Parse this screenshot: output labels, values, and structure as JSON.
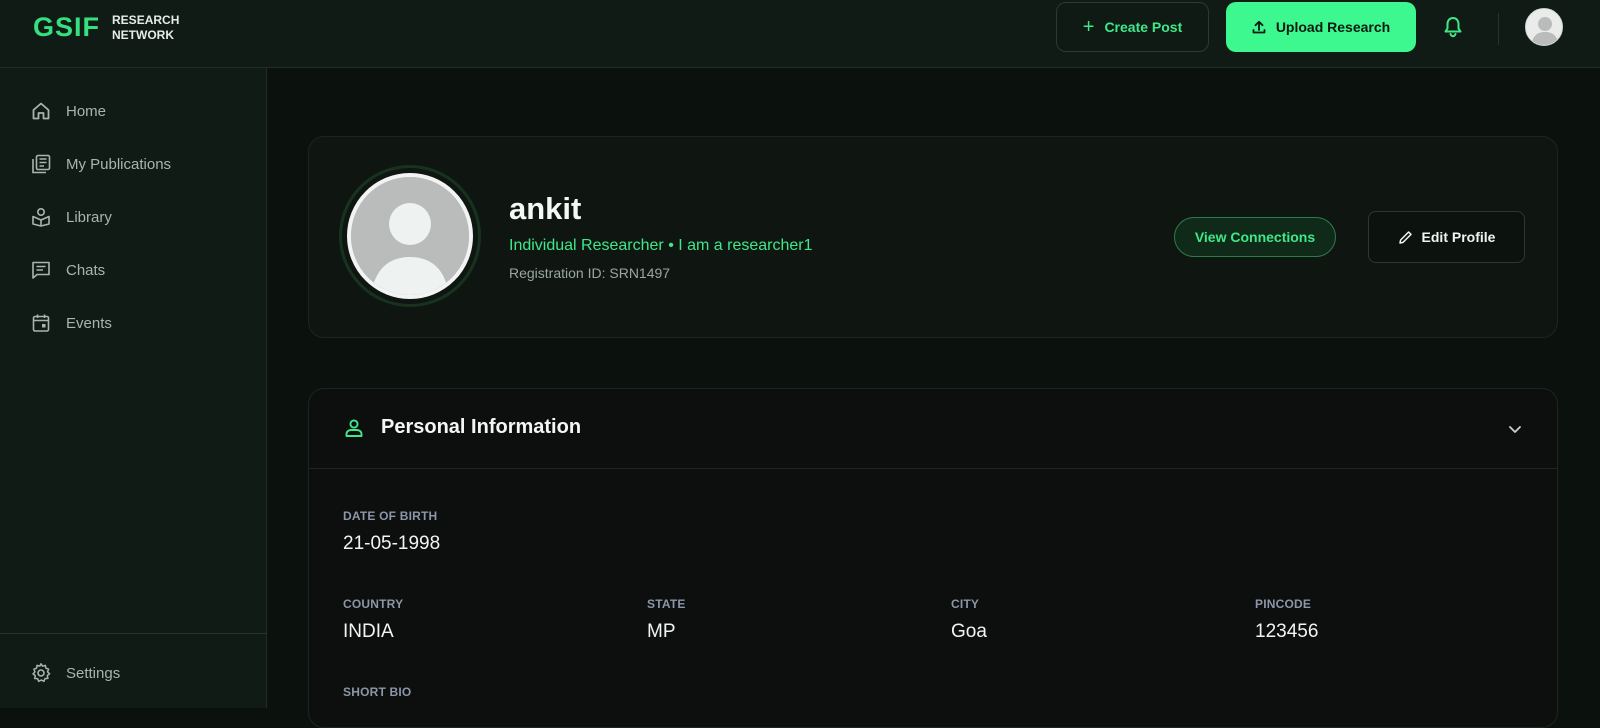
{
  "brand": {
    "logo": "GSIF",
    "line1": "RESEARCH",
    "line2": "NETWORK"
  },
  "topbar": {
    "create_post": "Create Post",
    "upload_research": "Upload Research"
  },
  "sidebar": {
    "items": [
      {
        "label": "Home",
        "icon": "home-icon"
      },
      {
        "label": "My Publications",
        "icon": "publications-icon"
      },
      {
        "label": "Library",
        "icon": "library-icon"
      },
      {
        "label": "Chats",
        "icon": "chat-icon"
      },
      {
        "label": "Events",
        "icon": "calendar-icon"
      }
    ],
    "settings": "Settings"
  },
  "profile": {
    "name": "ankit",
    "role_line": "Individual Researcher • I am a researcher1",
    "registration": "Registration ID: SRN1497",
    "view_connections": "View Connections",
    "edit_profile": "Edit Profile"
  },
  "personal_info": {
    "title": "Personal Information",
    "dob_label": "DATE OF BIRTH",
    "dob": "21-05-1998",
    "country_label": "COUNTRY",
    "country": "INDIA",
    "state_label": "STATE",
    "state": "MP",
    "city_label": "CITY",
    "city": "Goa",
    "pincode_label": "PINCODE",
    "pincode": "123456",
    "bio_label": "SHORT BIO"
  },
  "colors": {
    "accent": "#3df78f",
    "background": "#0b120e",
    "panel": "#111b15"
  }
}
